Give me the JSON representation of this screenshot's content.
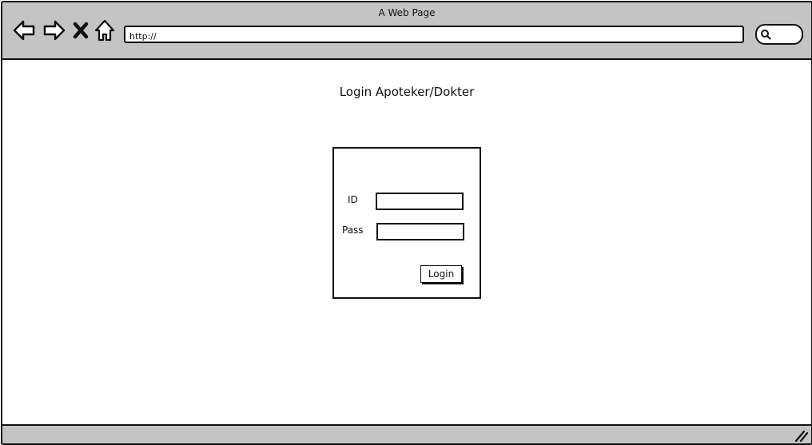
{
  "browser": {
    "title": "A Web Page",
    "url_value": "http://",
    "icons": {
      "back": "back-arrow-icon",
      "forward": "forward-arrow-icon",
      "stop": "close-icon",
      "home": "home-icon",
      "search": "search-icon",
      "resize": "resize-grip-icon"
    }
  },
  "page": {
    "heading": "Login Apoteker/Dokter"
  },
  "login_form": {
    "id_label": "ID",
    "id_value": "",
    "pass_label": "Pass",
    "pass_value": "",
    "login_button": "Login"
  }
}
